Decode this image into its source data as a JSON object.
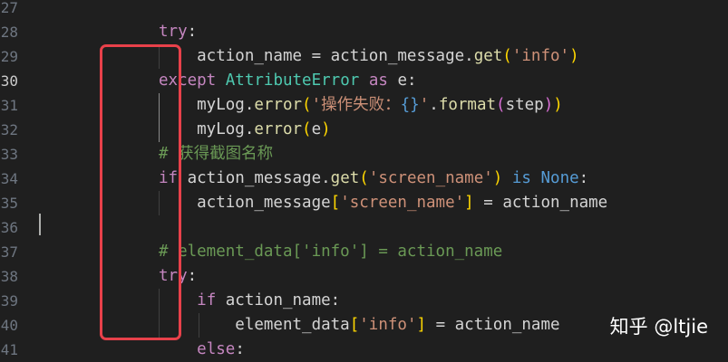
{
  "editor": {
    "line_numbers": [
      "27",
      "28",
      "29",
      "30",
      "31",
      "32",
      "33",
      "34",
      "35",
      "36",
      "37",
      "38",
      "39",
      "40",
      "41"
    ],
    "lines": [
      {
        "n": "27",
        "tokens": []
      },
      {
        "n": "28",
        "tokens": [
          {
            "t": "try",
            "c": "kw-ctrl"
          },
          {
            "t": ":",
            "c": "var"
          }
        ]
      },
      {
        "n": "29",
        "tokens": [
          {
            "t": "    action_name = action_message.",
            "c": "var"
          },
          {
            "t": "get",
            "c": "fn"
          },
          {
            "t": "(",
            "c": "p1"
          },
          {
            "t": "'info'",
            "c": "str"
          },
          {
            "t": ")",
            "c": "p1"
          }
        ]
      },
      {
        "n": "30",
        "tokens": [
          {
            "t": "except",
            "c": "kw-ctrl"
          },
          {
            "t": " ",
            "c": "var"
          },
          {
            "t": "AttributeError",
            "c": "cls"
          },
          {
            "t": " ",
            "c": "var"
          },
          {
            "t": "as",
            "c": "kw-ctrl"
          },
          {
            "t": " e:",
            "c": "var"
          }
        ]
      },
      {
        "n": "31",
        "tokens": [
          {
            "t": "    myLog.",
            "c": "var"
          },
          {
            "t": "error",
            "c": "fn"
          },
          {
            "t": "(",
            "c": "p1"
          },
          {
            "t": "'操作失败：",
            "c": "str"
          },
          {
            "t": "{}",
            "c": "fmt"
          },
          {
            "t": "'",
            "c": "str"
          },
          {
            "t": ".",
            "c": "var"
          },
          {
            "t": "format",
            "c": "fn"
          },
          {
            "t": "(",
            "c": "p2"
          },
          {
            "t": "step",
            "c": "var"
          },
          {
            "t": ")",
            "c": "p2"
          },
          {
            "t": ")",
            "c": "p1"
          }
        ]
      },
      {
        "n": "32",
        "tokens": [
          {
            "t": "    myLog.",
            "c": "var"
          },
          {
            "t": "error",
            "c": "fn"
          },
          {
            "t": "(",
            "c": "p1"
          },
          {
            "t": "e",
            "c": "var"
          },
          {
            "t": ")",
            "c": "p1"
          }
        ]
      },
      {
        "n": "33",
        "tokens": [
          {
            "t": "# 获得截图名称",
            "c": "comment"
          }
        ]
      },
      {
        "n": "34",
        "tokens": [
          {
            "t": "if",
            "c": "kw-ctrl"
          },
          {
            "t": " action_message.",
            "c": "var"
          },
          {
            "t": "get",
            "c": "fn"
          },
          {
            "t": "(",
            "c": "p1"
          },
          {
            "t": "'screen_name'",
            "c": "str"
          },
          {
            "t": ")",
            "c": "p1"
          },
          {
            "t": " ",
            "c": "var"
          },
          {
            "t": "is",
            "c": "kw"
          },
          {
            "t": " ",
            "c": "var"
          },
          {
            "t": "None",
            "c": "kw"
          },
          {
            "t": ":",
            "c": "var"
          }
        ]
      },
      {
        "n": "35",
        "tokens": [
          {
            "t": "    action_message",
            "c": "var"
          },
          {
            "t": "[",
            "c": "p1"
          },
          {
            "t": "'screen_name'",
            "c": "str"
          },
          {
            "t": "]",
            "c": "p1"
          },
          {
            "t": " = action_name",
            "c": "var"
          }
        ]
      },
      {
        "n": "36",
        "tokens": []
      },
      {
        "n": "37",
        "tokens": [
          {
            "t": "# element_data['info'] = action_name",
            "c": "comment"
          }
        ]
      },
      {
        "n": "38",
        "tokens": [
          {
            "t": "try",
            "c": "kw-ctrl"
          },
          {
            "t": ":",
            "c": "var"
          }
        ]
      },
      {
        "n": "39",
        "tokens": [
          {
            "t": "    ",
            "c": "var"
          },
          {
            "t": "if",
            "c": "kw-ctrl"
          },
          {
            "t": " action_name:",
            "c": "var"
          }
        ]
      },
      {
        "n": "40",
        "tokens": [
          {
            "t": "        element_data",
            "c": "var"
          },
          {
            "t": "[",
            "c": "p1"
          },
          {
            "t": "'info'",
            "c": "str"
          },
          {
            "t": "]",
            "c": "p1"
          },
          {
            "t": " = action_name",
            "c": "var"
          }
        ]
      },
      {
        "n": "41",
        "tokens": [
          {
            "t": "    ",
            "c": "var"
          },
          {
            "t": "else",
            "c": "kw-ctrl"
          },
          {
            "t": ":",
            "c": "var"
          }
        ]
      }
    ],
    "active_line": "30",
    "colors": {
      "background": "#1f1f1f",
      "annotation_box": "#e8414a",
      "keyword": "#c586c0",
      "string": "#ce9178",
      "comment": "#6a9955",
      "function": "#dcdcaa",
      "class": "#4ec9b0"
    }
  },
  "watermark": {
    "text": "知乎 @ltjie"
  }
}
